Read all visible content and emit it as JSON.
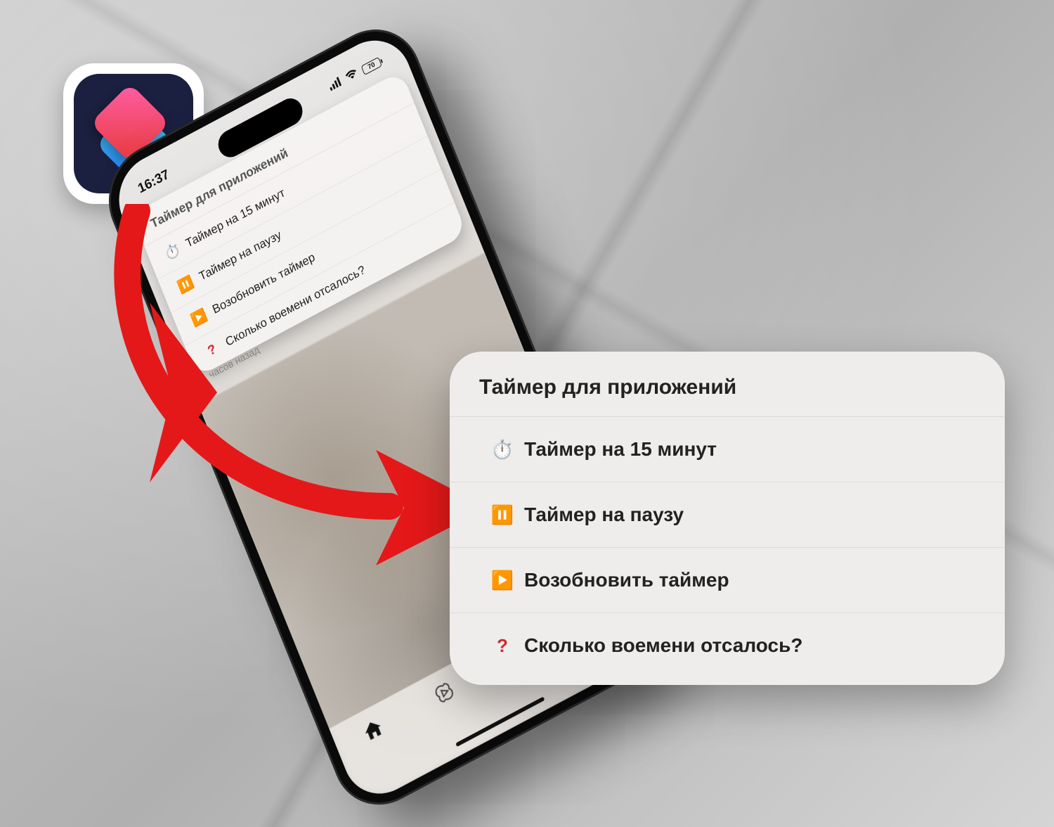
{
  "statusbar": {
    "time": "16:37",
    "battery": "70"
  },
  "phone_timestamp": "часов назад",
  "popup_title": "Таймер для приложений",
  "items": [
    {
      "icon": "⏱️",
      "label": "Таймер на 15 минут"
    },
    {
      "icon": "⏸️",
      "label": "Таймер на паузу"
    },
    {
      "icon": "▶️",
      "label": "Возобновить таймер"
    },
    {
      "icon": "❓",
      "label": "Сколько воемени отсалось?"
    }
  ]
}
